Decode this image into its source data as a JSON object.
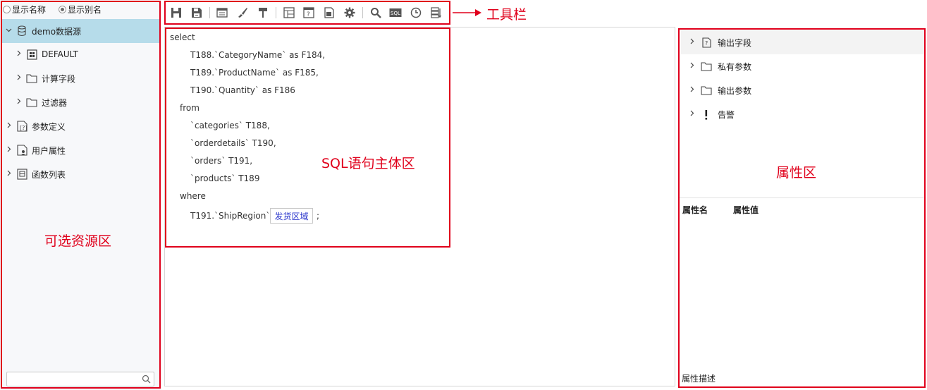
{
  "left_panel": {
    "radios": [
      {
        "label": "显示名称",
        "checked": false
      },
      {
        "label": "显示别名",
        "checked": true
      }
    ],
    "tree": [
      {
        "label": "demo数据源",
        "icon": "database-icon",
        "expanded": true,
        "selected": true
      },
      {
        "label": "DEFAULT",
        "icon": "schema-grid-icon",
        "expanded": false
      },
      {
        "label": "计算字段",
        "icon": "folder-icon",
        "expanded": false
      },
      {
        "label": "过滤器",
        "icon": "folder-icon",
        "expanded": false
      },
      {
        "label": "参数定义",
        "icon": "param-def-icon",
        "expanded": false
      },
      {
        "label": "用户属性",
        "icon": "user-attr-icon",
        "expanded": false
      },
      {
        "label": "函数列表",
        "icon": "function-list-icon",
        "expanded": false
      }
    ],
    "search_placeholder": "",
    "annotation": "可选资源区"
  },
  "toolbar": {
    "buttons": [
      "save-icon",
      "save-as-icon",
      "sep",
      "layout-icon",
      "brush-icon",
      "format-icon",
      "sep",
      "table-icon",
      "help-doc-icon",
      "export-icon",
      "gear-icon",
      "sep",
      "search-icon",
      "sql-icon",
      "clock-icon",
      "settings-list-icon"
    ],
    "sql_icon_text": "SQL",
    "annotation": "工具栏"
  },
  "sql_editor": {
    "lines": [
      "select",
      "T188.`CategoryName` as F184,",
      "T189.`ProductName` as F185,",
      "T190.`Quantity` as F186",
      "from",
      "`categories` T188,",
      "`orderdetails` T190,",
      "`orders` T191,",
      "`products` T189",
      "where",
      "T191.`ShipRegion`="
    ],
    "param_chip": "发货区域",
    "terminator": ";",
    "annotation": "SQL语句主体区"
  },
  "right_panel": {
    "items": [
      {
        "label": "输出字段",
        "icon": "output-field-icon"
      },
      {
        "label": "私有参数",
        "icon": "folder-icon"
      },
      {
        "label": "输出参数",
        "icon": "folder-icon"
      },
      {
        "label": "告警",
        "icon": "alert-icon"
      }
    ],
    "annotation": "属性区",
    "prop_name_header": "属性名",
    "prop_value_header": "属性值",
    "prop_description": "属性描述"
  },
  "colors": {
    "annotation_red": "#e0001b",
    "selection_blue": "#b6dcea",
    "param_text_blue": "#2a35cc"
  }
}
